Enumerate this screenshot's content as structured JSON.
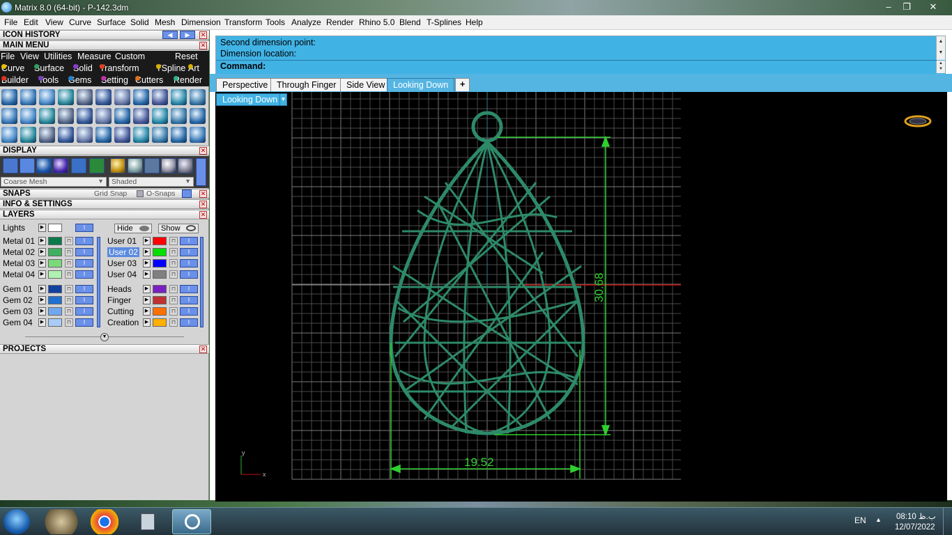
{
  "window": {
    "title": "Matrix 8.0 (64-bit) - P-142.3dm",
    "min_glyph": "–",
    "max_glyph": "❐",
    "close_glyph": "✕"
  },
  "menu": [
    "File",
    "Edit",
    "View",
    "Curve",
    "Surface",
    "Solid",
    "Mesh",
    "Dimension",
    "Transform",
    "Tools",
    "Analyze",
    "Render",
    "Rhino 5.0",
    "Blend",
    "T-Splines",
    "Help"
  ],
  "panel": {
    "icon_history": "ICON HISTORY",
    "main_menu": "MAIN MENU",
    "main_menu_items": [
      "File",
      "View",
      "Utilities",
      "Measure",
      "Custom"
    ],
    "reset": "Reset",
    "builders_row1": [
      {
        "label": "Curve",
        "color": "#e8c000"
      },
      {
        "label": "Surface",
        "color": "#30a060"
      },
      {
        "label": "Solid",
        "color": "#8a3ad0"
      },
      {
        "label": "Transform",
        "color": "#e04020"
      },
      {
        "label": "TSpline",
        "color": "#d8b000"
      },
      {
        "label": "Art",
        "color": "#d8b000"
      }
    ],
    "builders_row2": [
      {
        "label": "Builder",
        "color": "#e03020"
      },
      {
        "label": "Tools",
        "color": "#7a40c0"
      },
      {
        "label": "Gems",
        "color": "#2080d0"
      },
      {
        "label": "Setting",
        "color": "#c030a0"
      },
      {
        "label": "Cutters",
        "color": "#e07020"
      },
      {
        "label": "Render",
        "color": "#30b090"
      }
    ],
    "display": "DISPLAY",
    "mesh_option": "Coarse Mesh",
    "shade_option": "Shaded",
    "snaps": "SNAPS",
    "grid_snap": "Grid Snap",
    "osnaps": "O-Snaps",
    "info": "INFO & SETTINGS",
    "layers": "LAYERS",
    "lights": "Lights",
    "hide": "Hide",
    "show": "Show",
    "projects": "PROJECTS"
  },
  "layers_left": [
    {
      "name": "Metal 01",
      "color": "#0a7a4a"
    },
    {
      "name": "Metal 02",
      "color": "#40b060"
    },
    {
      "name": "Metal 03",
      "color": "#7ada7a"
    },
    {
      "name": "Metal 04",
      "color": "#b0f0b0"
    },
    {
      "name": "Gem 01",
      "color": "#1040a0"
    },
    {
      "name": "Gem 02",
      "color": "#2070d0"
    },
    {
      "name": "Gem 03",
      "color": "#70a8f0"
    },
    {
      "name": "Gem 04",
      "color": "#a8ccf6"
    }
  ],
  "layers_right": [
    {
      "name": "User 01",
      "color": "#ff0000"
    },
    {
      "name": "User 02",
      "color": "#00e000",
      "selected": true
    },
    {
      "name": "User 03",
      "color": "#0000ff"
    },
    {
      "name": "User 04",
      "color": "#808080"
    },
    {
      "name": "Heads",
      "color": "#7a20c0"
    },
    {
      "name": "Finger",
      "color": "#c03030"
    },
    {
      "name": "Cutting",
      "color": "#ff7000"
    },
    {
      "name": "Creation",
      "color": "#ffb000"
    }
  ],
  "command": {
    "line1": "Second dimension point:",
    "line2": "Dimension location:",
    "prompt": "Command:"
  },
  "tabs": [
    "Perspective",
    "Through Finger",
    "Side View",
    "Looking Down"
  ],
  "active_tab": "Looking Down",
  "add_tab": "+",
  "viewport": {
    "name": "Looking Down",
    "dim_height": "30.68",
    "dim_width": "19.52",
    "axis_y": "y",
    "axis_x": "x"
  },
  "taskbar": {
    "lang": "EN",
    "time": "08:10 ب.ظ",
    "date": "12/07/2022",
    "tray_arrow": "▲"
  }
}
